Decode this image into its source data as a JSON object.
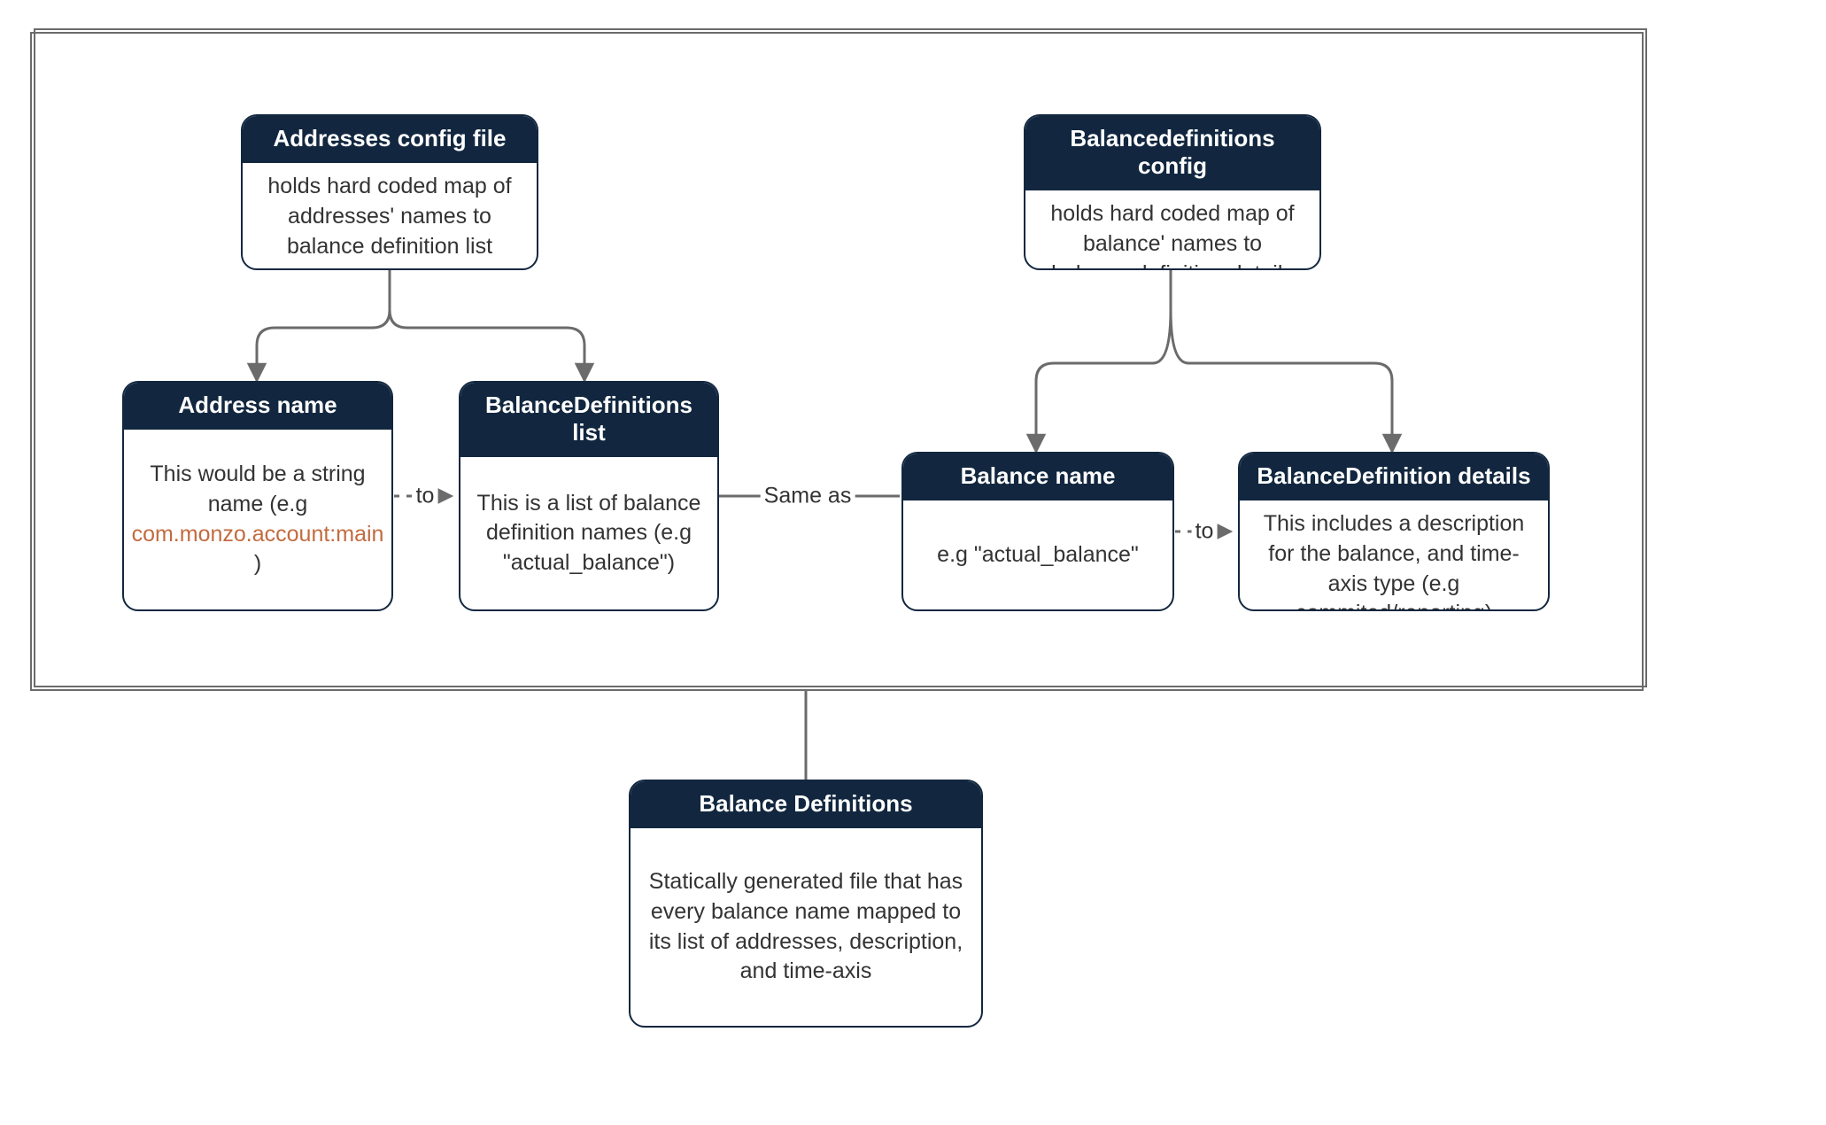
{
  "nodes": {
    "addresses_config": {
      "title": "Addresses config file",
      "body": "holds hard coded map of addresses' names to balance definition list"
    },
    "balancedef_config": {
      "title": "Balancedefinitions config",
      "body": "holds hard coded map of balance' names to balance definition details struct"
    },
    "address_name": {
      "title": "Address name",
      "body_prefix": "This would be a string name (e.g ",
      "body_code": "com.monzo.account:main",
      "body_suffix": " )"
    },
    "baldef_list": {
      "title": "BalanceDefinitions list",
      "body": "This is a list of balance definition names (e.g \"actual_balance\")"
    },
    "balance_name": {
      "title": "Balance name",
      "body": "e.g \"actual_balance\""
    },
    "baldef_details": {
      "title": "BalanceDefinition details",
      "body": "This includes a description for the balance, and time-axis type (e.g commited/reporting)"
    },
    "balance_definitions": {
      "title": "Balance Definitions",
      "body": "Statically generated file that has every balance name mapped to its list of addresses, description, and time-axis"
    }
  },
  "edges": {
    "to1": "to",
    "same_as": "Same as",
    "to2": "to"
  },
  "colors": {
    "header_bg": "#12273f",
    "code": "#c26b3f",
    "wire": "#6b6b6b"
  }
}
